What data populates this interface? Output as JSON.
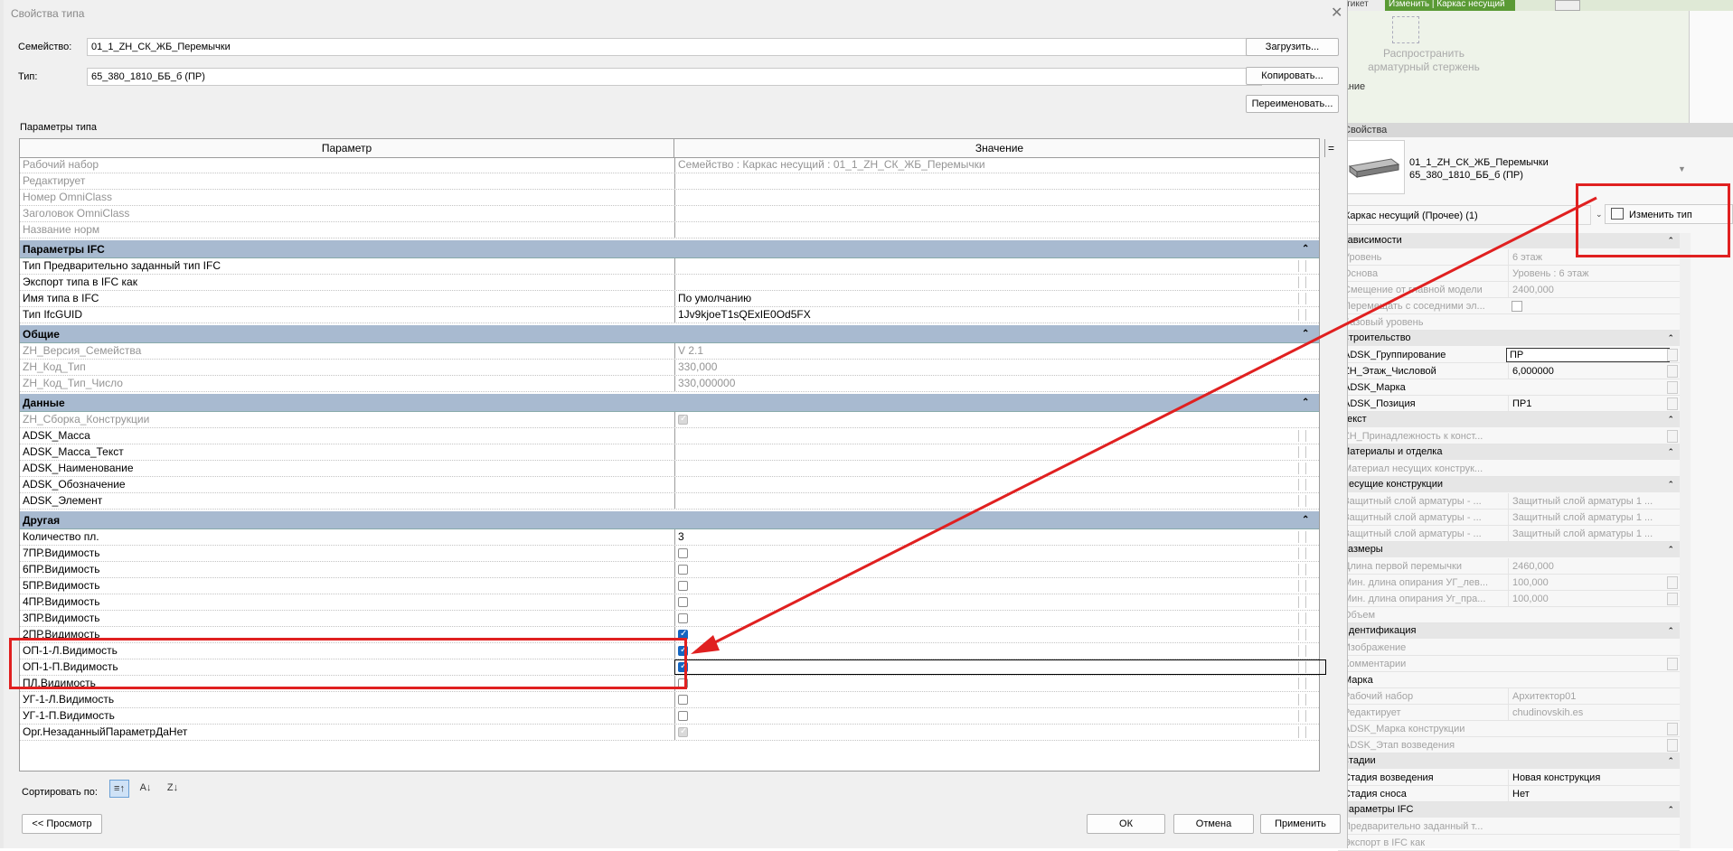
{
  "dialog": {
    "title": "Свойства типа",
    "family_label": "Семейство:",
    "family_value": "01_1_ZH_СК_ЖБ_Перемычки",
    "type_label": "Тип:",
    "type_value": "65_380_1810_ББ_б (ПР)",
    "load_button": "Загрузить...",
    "copy_button": "Копировать...",
    "rename_button": "Переименовать...",
    "params_label": "Параметры типа",
    "col_param": "Параметр",
    "col_value": "Значение",
    "col_eq": "=",
    "sort_label": "Сортировать по:",
    "preview_button": "<< Просмотр",
    "ok_button": "ОК",
    "cancel_button": "Отмена",
    "apply_button": "Применить",
    "close_icon": "close-icon"
  },
  "grid": {
    "top_rows": [
      {
        "name": "Рабочий набор",
        "value": "Семейство  : Каркас несущий : 01_1_ZH_СК_ЖБ_Перемычки",
        "grey": true
      },
      {
        "name": "Редактирует",
        "value": "",
        "grey": true
      },
      {
        "name": "Номер OmniClass",
        "value": "",
        "grey": true
      },
      {
        "name": "Заголовок OmniClass",
        "value": "",
        "grey": true
      },
      {
        "name": "Название норм",
        "value": "",
        "grey": true
      }
    ],
    "sections": [
      {
        "title": "Параметры IFC",
        "rows": [
          {
            "name": "Тип Предварительно заданный тип IFC",
            "value": ""
          },
          {
            "name": "Экспорт типа в IFC как",
            "value": ""
          },
          {
            "name": "Имя типа в IFC",
            "value": "По умолчанию"
          },
          {
            "name": "Тип IfcGUID",
            "value": "1Jv9kjoeT1sQExIE0Od5FX"
          }
        ]
      },
      {
        "title": "Общие",
        "rows": [
          {
            "name": "ZH_Версия_Семейства",
            "value": "V 2.1",
            "grey": true
          },
          {
            "name": "ZH_Код_Тип",
            "value": "330,000",
            "grey": true
          },
          {
            "name": "ZH_Код_Тип_Число",
            "value": "330,000000",
            "grey": true
          }
        ]
      },
      {
        "title": "Данные",
        "rows": [
          {
            "name": "ZH_Сборка_Конструкции",
            "check": "disabled",
            "grey": true
          },
          {
            "name": "ADSK_Масса",
            "value": ""
          },
          {
            "name": "ADSK_Масса_Текст",
            "value": ""
          },
          {
            "name": "ADSK_Наименование",
            "value": ""
          },
          {
            "name": "ADSK_Обозначение",
            "value": ""
          },
          {
            "name": "ADSK_Элемент",
            "value": ""
          }
        ]
      },
      {
        "title": "Другая",
        "rows": [
          {
            "name": "Количество пл.",
            "value": "3"
          },
          {
            "name": "7ПР.Видимость",
            "check": "off"
          },
          {
            "name": "6ПР.Видимость",
            "check": "off"
          },
          {
            "name": "5ПР.Видимость",
            "check": "off"
          },
          {
            "name": "4ПР.Видимость",
            "check": "off"
          },
          {
            "name": "3ПР.Видимость",
            "check": "off"
          },
          {
            "name": "2ПР.Видимость",
            "check": "on"
          },
          {
            "name": "ОП-1-Л.Видимость",
            "check": "on"
          },
          {
            "name": "ОП-1-П.Видимость",
            "check": "on",
            "selected": true
          },
          {
            "name": "ПЛ.Видимость",
            "check": "off"
          },
          {
            "name": "УГ-1-Л.Видимость",
            "check": "off"
          },
          {
            "name": "УГ-1-П.Видимость",
            "check": "off"
          },
          {
            "name": "Орг.НезаданныйПараметрДаНет",
            "check": "disabled"
          }
        ]
      }
    ]
  },
  "ribbon": {
    "tab_left": "Этикет",
    "tab_active": "Изменить | Каркас несущий",
    "spread_label": "Распространить арматурный стержень",
    "group_label": "вание"
  },
  "properties": {
    "header": "Свойства",
    "family_line1": "01_1_ZH_СК_ЖБ_Перемычки",
    "family_line2": "65_380_1810_ББ_б (ПР)",
    "category": "Каркас несущий (Прочее) (1)",
    "edit_type": "Изменить тип",
    "sections": [
      {
        "title": "Зависимости",
        "rows": [
          {
            "name": "Уровень",
            "value": "6 этаж",
            "grey": true
          },
          {
            "name": "Основа",
            "value": "Уровень : 6 этаж",
            "grey": true
          },
          {
            "name": "Смещение от главной модели",
            "value": "2400,000",
            "grey": true
          },
          {
            "name": "Перемещать с соседними эл...",
            "value": "",
            "cb": true,
            "grey": true
          },
          {
            "name": "Базовый уровень",
            "value": "",
            "grey": true
          }
        ]
      },
      {
        "title": "Строительство",
        "rows": [
          {
            "name": "ADSK_Группирование",
            "value": "ПР",
            "edit": true,
            "sq": true
          },
          {
            "name": "ZH_Этаж_Числовой",
            "value": "6,000000",
            "sq": true
          },
          {
            "name": "ADSK_Марка",
            "value": "",
            "sq": true
          },
          {
            "name": "ADSK_Позиция",
            "value": "ПР1",
            "sq": true
          }
        ]
      },
      {
        "title": "Текст",
        "rows": [
          {
            "name": "ZH_Принадлежность к конст...",
            "value": "",
            "grey": true,
            "sq": true
          }
        ]
      },
      {
        "title": "Материалы и отделка",
        "rows": [
          {
            "name": "Материал несущих конструк...",
            "value": "",
            "grey": true
          }
        ]
      },
      {
        "title": "Несущие конструкции",
        "rows": [
          {
            "name": "Защитный слой арматуры - ...",
            "value": "Защитный слой арматуры 1 ...",
            "grey": true
          },
          {
            "name": "Защитный слой арматуры - ...",
            "value": "Защитный слой арматуры 1 ...",
            "grey": true
          },
          {
            "name": "Защитный слой арматуры - ...",
            "value": "Защитный слой арматуры 1 ...",
            "grey": true
          }
        ]
      },
      {
        "title": "Размеры",
        "rows": [
          {
            "name": "Длина первой перемычки",
            "value": "2460,000",
            "grey": true
          },
          {
            "name": "Мин. длина опирания УГ_лев...",
            "value": "100,000",
            "grey": true,
            "sq": true
          },
          {
            "name": "Мин. длина опирания Уг_пра...",
            "value": "100,000",
            "grey": true,
            "sq": true
          },
          {
            "name": "Объем",
            "value": "",
            "grey": true
          }
        ]
      },
      {
        "title": "Идентификация",
        "rows": [
          {
            "name": "Изображение",
            "value": "",
            "grey": true
          },
          {
            "name": "Комментарии",
            "value": "",
            "grey": true,
            "sq": true
          },
          {
            "name": "Марка",
            "value": ""
          },
          {
            "name": "Рабочий набор",
            "value": "Архитектор01",
            "grey": true
          },
          {
            "name": "Редактирует",
            "value": "chudinovskih.es",
            "grey": true
          },
          {
            "name": "ADSK_Марка конструкции",
            "value": "",
            "grey": true,
            "sq": true
          },
          {
            "name": "ADSK_Этап возведения",
            "value": "",
            "grey": true,
            "sq": true
          }
        ]
      },
      {
        "title": "Стадии",
        "rows": [
          {
            "name": "Стадия возведения",
            "value": "Новая конструкция"
          },
          {
            "name": "Стадия сноса",
            "value": "Нет"
          }
        ]
      },
      {
        "title": "Параметры IFC",
        "rows": [
          {
            "name": "Предварительно заданный т...",
            "value": "",
            "grey": true
          },
          {
            "name": "Экспорт в IFC как",
            "value": "",
            "grey": true
          }
        ]
      }
    ]
  },
  "colors": {
    "section_header": "#a8bad0",
    "checkbox_on": "#1565c0",
    "annotation": "#e02020",
    "ribbon_active": "#5a9a35"
  }
}
